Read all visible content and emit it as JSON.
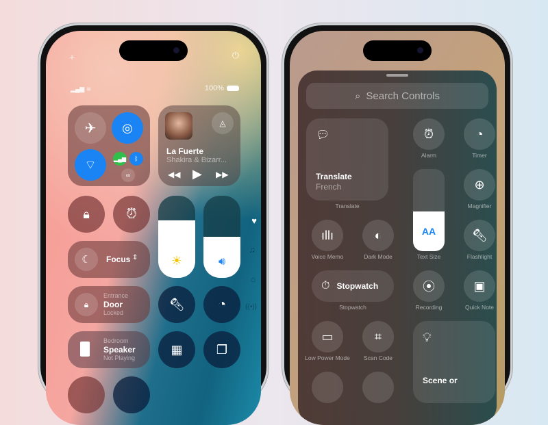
{
  "left_phone": {
    "status": {
      "battery_text": "100%",
      "add_icon": "plus-icon",
      "power_icon": "power-icon"
    },
    "connectivity": {
      "airplane": "airplane-icon",
      "airdrop": "airdrop-icon",
      "wifi": "wifi-icon",
      "cellular": "cellular-icon",
      "bluetooth": "bluetooth-icon",
      "hotspot": "link-icon"
    },
    "now_playing": {
      "title": "La Fuerte",
      "artist": "Shakira & Bizarr..."
    },
    "focus": {
      "label": "Focus"
    },
    "door": {
      "sub": "Entrance",
      "title": "Door",
      "state": "Locked"
    },
    "speaker": {
      "sub": "Bedroom",
      "title": "Speaker",
      "state": "Not Playing"
    },
    "brightness_level": 0.7,
    "volume_level": 0.5,
    "accent": "#1a84f4"
  },
  "right_phone": {
    "search_placeholder": "Search Controls",
    "translate": {
      "title": "Translate",
      "sub": "French",
      "caption": "Translate"
    },
    "controls": [
      {
        "label": "Alarm"
      },
      {
        "label": "Timer"
      },
      {
        "label": "Magnifier"
      },
      {
        "label": "Voice Memo"
      },
      {
        "label": "Dark Mode"
      },
      {
        "label": "Text Size"
      },
      {
        "label": "Flashlight"
      },
      {
        "label": "Stopwatch"
      },
      {
        "label": "Recording"
      },
      {
        "label": "Quick Note"
      },
      {
        "label": "Low Power Mode"
      },
      {
        "label": "Scan Code"
      }
    ],
    "stopwatch_button": "Stopwatch",
    "text_size_glyph": "AA",
    "scene": {
      "title": "Scene or"
    }
  }
}
